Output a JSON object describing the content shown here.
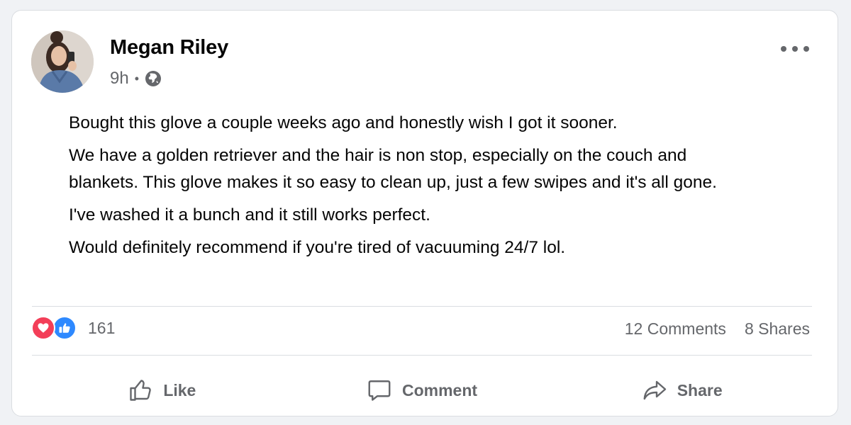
{
  "post": {
    "author": "Megan Riley",
    "time": "9h",
    "separator": "•",
    "visibility_icon": "globe-icon",
    "more_icon": "more-options-icon",
    "body": [
      "Bought this glove a couple weeks ago and honestly wish I got it sooner.",
      "We have a golden retriever and the hair is non stop, especially on the couch and blankets. This glove makes it so easy to clean up, just a few swipes and it's all gone.",
      "I've washed it a bunch and it still works perfect.",
      "Would definitely recommend if you're tired of vacuuming 24/7 lol."
    ]
  },
  "stats": {
    "reaction_icons": [
      "heart-icon",
      "like-icon"
    ],
    "reactions": "161",
    "comments": "12 Comments",
    "shares": "8 Shares"
  },
  "actions": {
    "like": "Like",
    "comment": "Comment",
    "share": "Share"
  },
  "colors": {
    "heart": "#f33e58",
    "like": "#2e89ff",
    "text": "#050505",
    "secondary_text": "#65676b",
    "divider": "#dadde1"
  }
}
